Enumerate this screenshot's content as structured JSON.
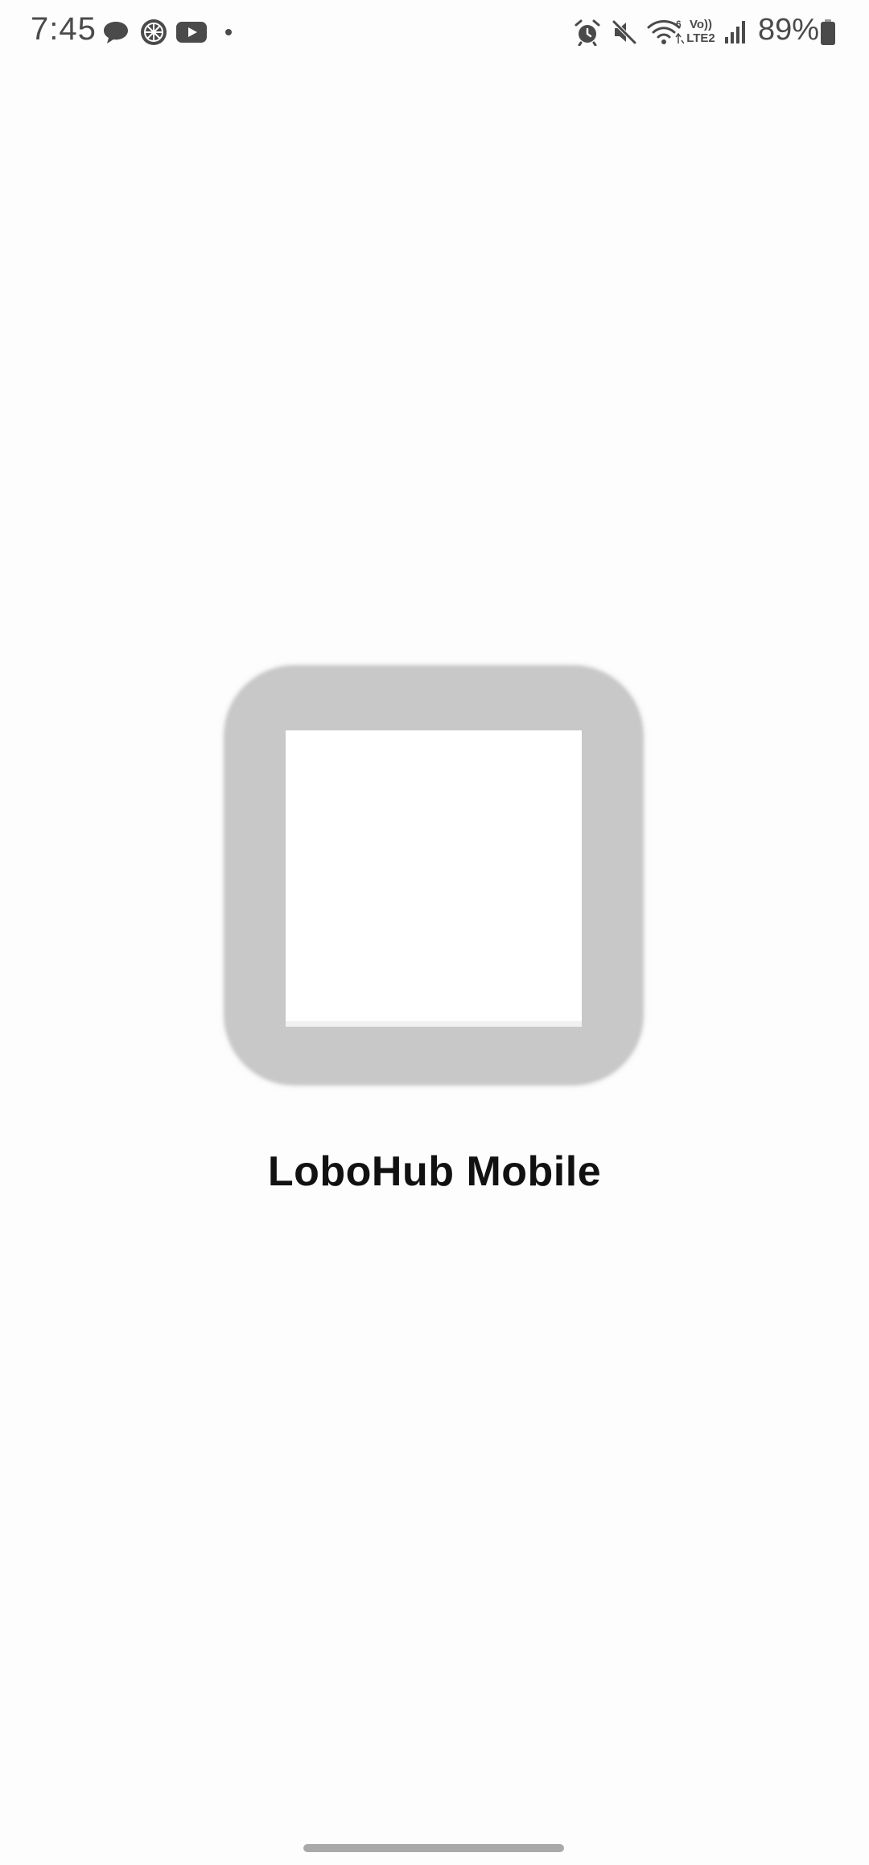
{
  "status_bar": {
    "time": "7:45",
    "battery_percent": "89%",
    "notification_icons": [
      "chat-bubble-icon",
      "orange-app-icon",
      "youtube-icon",
      "more-notifications-dot-icon"
    ],
    "system_icons": [
      "alarm-icon",
      "mute-icon",
      "wifi-icon",
      "volte-lte2-icon",
      "signal-icon",
      "battery-icon"
    ],
    "volte_label": "Vo))",
    "lte_label": "LTE2",
    "wifi_badge": "6"
  },
  "splash": {
    "app_name": "LoboHub Mobile",
    "logo_frame_color": "#c8c8c8",
    "logo_inner_color": "#ffffff"
  },
  "colors": {
    "background": "#fdfdfd",
    "status_text": "#4b4b4b",
    "title_text": "#111111",
    "home_indicator": "#a9a9a9"
  }
}
